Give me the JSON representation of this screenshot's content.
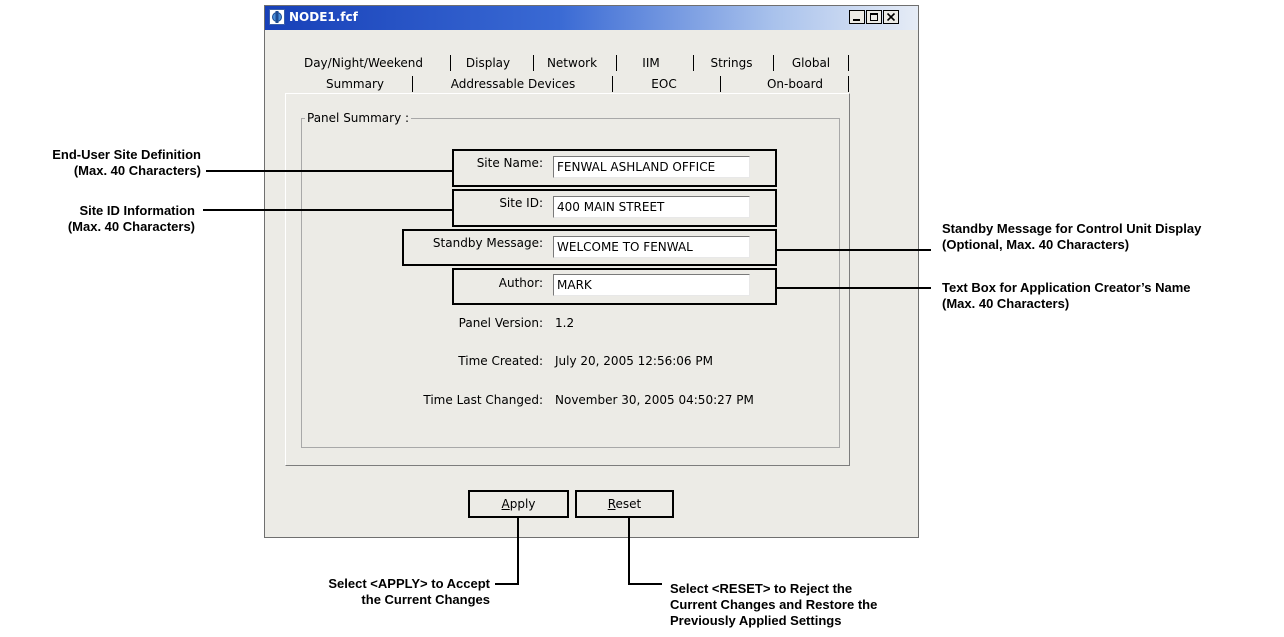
{
  "window": {
    "title": "NODE1.fcf"
  },
  "tabs": {
    "row1": [
      "Day/Night/Weekend",
      "Display",
      "Network",
      "IIM",
      "Strings",
      "Global"
    ],
    "row2": [
      "Summary",
      "Addressable Devices",
      "EOC",
      "On-board"
    ]
  },
  "panel": {
    "group_label": "Panel Summary :",
    "site_name_label": "Site Name:",
    "site_name_value": "FENWAL ASHLAND OFFICE",
    "site_id_label": "Site ID:",
    "site_id_value": "400 MAIN STREET",
    "standby_label": "Standby Message:",
    "standby_value": "WELCOME TO FENWAL",
    "author_label": "Author:",
    "author_value": "MARK",
    "version_label": "Panel Version:",
    "version_value": "1.2",
    "created_label": "Time Created:",
    "created_value": "July 20, 2005 12:56:06 PM",
    "changed_label": "Time Last Changed:",
    "changed_value": "November 30, 2005 04:50:27 PM"
  },
  "buttons": {
    "apply_mnemonic": "A",
    "apply_rest": "pply",
    "reset_mnemonic": "R",
    "reset_rest": "eset"
  },
  "callouts": {
    "site_def_l1": "End-User Site Definition",
    "site_def_l2": "(Max. 40 Characters)",
    "site_id_l1": "Site ID Information",
    "site_id_l2": "(Max. 40 Characters)",
    "standby_l1": "Standby Message for Control Unit Display",
    "standby_l2": "(Optional, Max. 40 Characters)",
    "author_l1": "Text Box for Application Creator’s Name",
    "author_l2": "(Max. 40 Characters)",
    "apply_l1": "Select <APPLY> to Accept",
    "apply_l2": "the Current Changes",
    "reset_l1": "Select <RESET> to Reject the",
    "reset_l2": "Current Changes and Restore the",
    "reset_l3": "Previously Applied Settings"
  },
  "colors": {
    "titlebar_start": "#1740b8",
    "titlebar_end": "#e6ecf6",
    "window_bg": "#ecebe6"
  }
}
